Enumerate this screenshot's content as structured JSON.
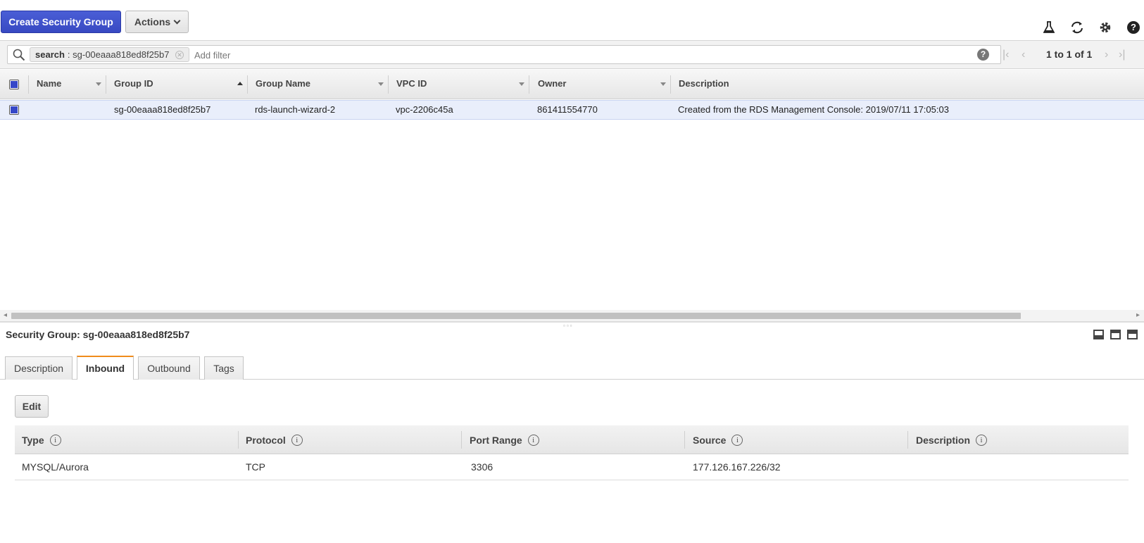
{
  "toolbar": {
    "create_label": "Create Security Group",
    "actions_label": "Actions",
    "icons": [
      "flask-icon",
      "refresh-icon",
      "gear-icon",
      "help-icon"
    ]
  },
  "filter": {
    "token_key": "search",
    "token_value": ": sg-00eaaa818ed8f25b7",
    "placeholder": "Add filter",
    "pager_text": "1 to 1 of 1"
  },
  "grid": {
    "columns": [
      "Name",
      "Group ID",
      "Group Name",
      "VPC ID",
      "Owner",
      "Description"
    ],
    "rows": [
      {
        "name": "",
        "group_id": "sg-00eaaa818ed8f25b7",
        "group_name": "rds-launch-wizard-2",
        "vpc_id": "vpc-2206c45a",
        "owner": "861411554770",
        "description": "Created from the RDS Management Console: 2019/07/11 17:05:03"
      }
    ]
  },
  "details": {
    "title": "Security Group: sg-00eaaa818ed8f25b7",
    "tabs": [
      "Description",
      "Inbound",
      "Outbound",
      "Tags"
    ],
    "active_tab": "Inbound",
    "edit_label": "Edit",
    "rule_columns": [
      "Type",
      "Protocol",
      "Port Range",
      "Source",
      "Description"
    ],
    "rules": [
      {
        "type": "MYSQL/Aurora",
        "protocol": "TCP",
        "port_range": "3306",
        "source": "177.126.167.226/32",
        "description": ""
      }
    ]
  },
  "colors": {
    "primary": "#3849c2",
    "tab_accent": "#f08c1c",
    "selected_row": "#e9eefb"
  }
}
